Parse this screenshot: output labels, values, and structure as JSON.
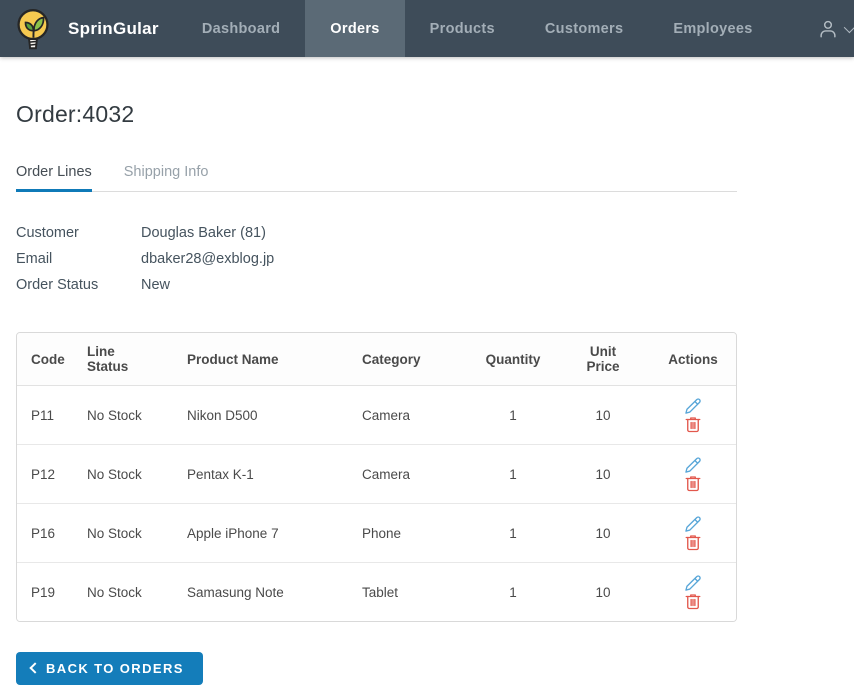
{
  "brand": {
    "name": "SprinGular"
  },
  "nav": {
    "items": [
      {
        "label": "Dashboard",
        "active": false
      },
      {
        "label": "Orders",
        "active": true
      },
      {
        "label": "Products",
        "active": false
      },
      {
        "label": "Customers",
        "active": false
      },
      {
        "label": "Employees",
        "active": false
      }
    ]
  },
  "page": {
    "title": "Order:4032"
  },
  "tabs": [
    {
      "label": "Order Lines",
      "active": true
    },
    {
      "label": "Shipping Info",
      "active": false
    }
  ],
  "details": [
    {
      "label": "Customer",
      "value": "Douglas Baker (81)"
    },
    {
      "label": "Email",
      "value": "dbaker28@exblog.jp"
    },
    {
      "label": "Order Status",
      "value": "New"
    }
  ],
  "table": {
    "headers": [
      "Code",
      "Line Status",
      "Product Name",
      "Category",
      "Quantity",
      "Unit Price",
      "Actions"
    ],
    "rows": [
      {
        "code": "P11",
        "line_status": "No Stock",
        "product_name": "Nikon D500",
        "category": "Camera",
        "quantity": "1",
        "unit_price": "10"
      },
      {
        "code": "P12",
        "line_status": "No Stock",
        "product_name": "Pentax K-1",
        "category": "Camera",
        "quantity": "1",
        "unit_price": "10"
      },
      {
        "code": "P16",
        "line_status": "No Stock",
        "product_name": "Apple iPhone 7",
        "category": "Phone",
        "quantity": "1",
        "unit_price": "10"
      },
      {
        "code": "P19",
        "line_status": "No Stock",
        "product_name": "Samasung Note",
        "category": "Tablet",
        "quantity": "1",
        "unit_price": "10"
      }
    ]
  },
  "actions": {
    "back_label": "BACK TO ORDERS"
  },
  "colors": {
    "navbar_bg": "#3e4c59",
    "navbar_active_bg": "#5b6a76",
    "accent_blue": "#147dba",
    "edit_icon": "#58a6d8",
    "delete_icon": "#e2574c",
    "logo_bulb": "#f6c950",
    "logo_leaf": "#8bc34a"
  }
}
